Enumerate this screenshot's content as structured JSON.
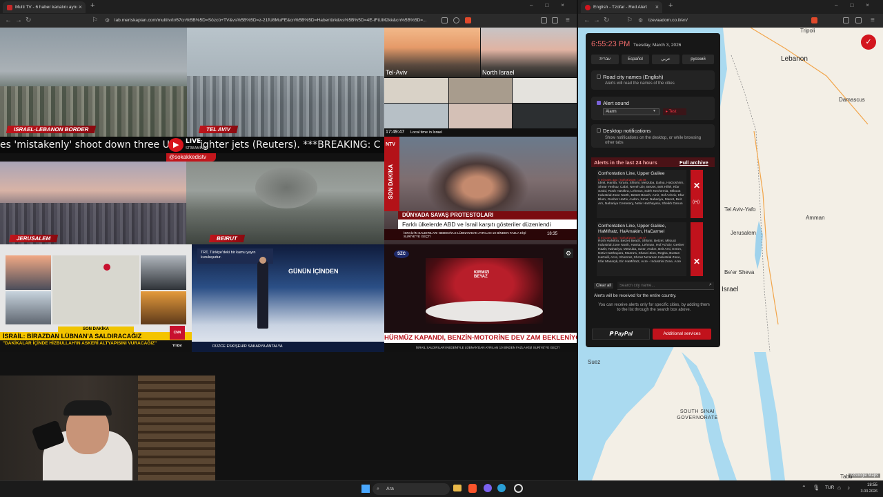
{
  "left_window": {
    "tab_title": "Multi TV - 6 haber kanalını aynı",
    "url": "lab.mertskaplan.com/multitv/tr/67cn%5B%5D=Sözcü+TV&vs%5B%5D=z-21fU8MuFE&cn%5B%5D=Habertürk&vs%5B%5D=4E-iFtUM2kk&cn%5B%5D=..."
  },
  "videos": {
    "cell1_label": "ISRAEL-LEBANON BORDER",
    "cell2_label": "TEL AVIV",
    "cell3_label": "JERUSALEM",
    "cell4_label": "BEIRUT",
    "ticker": "es 'mistakenly' shoot down three U",
    "ticker_right": "ighter jets (Reuters). ***BREAKING: C",
    "live_badge": "LIVE",
    "live_sub": "STREAMING",
    "handle": "@sokakkedistv",
    "cam_tl": "Tel-Aviv",
    "cam_tr": "North Israel",
    "cam_time": "17:49:47",
    "cam_caption": "Local time in Israel",
    "ntv_son": "SON DAKİKA",
    "ntv_headline": "DÜNYADA SAVAŞ PROTESTOLARI",
    "ntv_sub": "Farklı ülkelerde ABD ve İsrail karşıtı gösteriler düzenlendi",
    "ntv_bottom": "İSRAİL'İN SALDIRILARI NEDENİYLE LÜBNAN'DAN AYRILAN 10 BİNDEN FAZLA KİŞİ SURİYE'YE GEÇTİ",
    "ntv_time": "18:35",
    "cnn_son": "SON DAKİKA",
    "cnn_head": "İSRAİL: BİRAZDAN LÜBNAN'A SALDIRACAĞIZ",
    "cnn_sub": "\"DAKİKALAR İÇİNDE HİZBULLAH'IN ASKERİ ALTYAPISINI VURACAĞIZ\"",
    "cnn_brand": "CNN TÜRK",
    "trt_note": "TRT, Türkiye'deki bir kamu yayın kuruluşudur.",
    "trt_show": "GÜNÜN İÇİNDEN",
    "trt_cities": "DÜZCE  ESKİŞEHİR  SAKARYA  ANTALYA",
    "szc_logo": "SZC",
    "szc_studio": "KIRMIZI BEYAZ",
    "szc_head": "HÜRMÜZ KAPANDI, BENZİN-MOTORİNE DEV ZAM BEKLENİYOR",
    "szc_bottom": "İSRAİL SALDIRILARI NEDENİYLE LÜBNAN'DAN AYRILAN 10 BİNDEN FAZLA KİŞİ SURİYE'YE GEÇTİ"
  },
  "right_window": {
    "tab_title": "English - Tzofar - Red Alert",
    "url": "tzevaadom.co.il/en/"
  },
  "tzofar": {
    "time": "6:55:23 PM",
    "date": "Tuesday, March 3, 2026",
    "languages": [
      "עברית",
      "Español",
      "عربي",
      "русский"
    ],
    "read_names_title": "Road city names (English)",
    "read_names_sub": "Alerts will read the names of the cities",
    "alert_sound_title": "Alert sound",
    "alert_sound_value": "Alarm",
    "test_button": "Test",
    "desktop_title": "Desktop notifications",
    "desktop_sub": "Show notifications on the desktop, or while browsing other tabs",
    "alerts_header": "Alerts in the last 24 hours",
    "full_archive": "Full archive",
    "alerts": [
      {
        "title": "Confrontation Line, Upper Galilee",
        "meta": "6 minutes ago | 03/03/2026 | 18:49",
        "cities": "Idmit, Hanita, Ya'ara, Shlomi, Metzuba, Dalna, HaGoshrim, Shear Yeshuv, Cabri, Neveh Ziv, Betzet, Beit Hillel, Kfar Szold, Rosh HaNikra, Lehman, Sdeh Nechemia, Milouot Industrial Zone North, Betzet Beach, Amir, Hof Achziv, Kfar Blum, Gesher HaZiv, Avdon, Sa'ar, Nahariya, Manot, Beit Am, Nahariya Cemetery, Netiv HaShayara, Sheikh Danun"
      },
      {
        "title": "Confrontation Line, Upper Galilee, HaMifratz, HaAmakim, HaCarmel",
        "meta": "8 minutes ago | 03/03/2026 | 18:47",
        "cities": "Rosh HaNikra, Betzet Beach, Shlomi, Betzet, Milouot Industrial Zone North, Hanita, Lehman, Hof Achziv, Gesher HaZiv, Nahariya, Metzuba, Sa'ar, Avdon, Beit Ami, Evron, Netiv HaShayara, Mazra'a, Shavei Zion, Regba, Bustan HaGalil, Acre, Shomrat, Sha'ar Ne'aman Industrial Zone, Kfar Masaryk, Ein HaMifratz, Acre - Industrial Zone, Acre"
      }
    ],
    "clear_all": "Clear all",
    "search_placeholder": "Search city name...",
    "entire_country": "Alerts will be received for the entire country.",
    "specific_cities": "You can receive alerts only for specific cities, by adding them to the list through the search box above.",
    "paypal": "PayPal",
    "additional_services": "Additional services"
  },
  "map": {
    "labels": [
      "Tripoli",
      "Lebanon",
      "Damascus",
      "Tel Aviv-Yafo",
      "Amman",
      "Jerusalem",
      "Be'er Sheva",
      "Israel",
      "Suez",
      "SOUTH SINAI GOVERNORATE",
      "Tabu",
      "©Google Maps"
    ]
  },
  "taskbar": {
    "search": "Ara",
    "lang": "TUR",
    "time": "18:55",
    "date": "3.03.2026"
  }
}
